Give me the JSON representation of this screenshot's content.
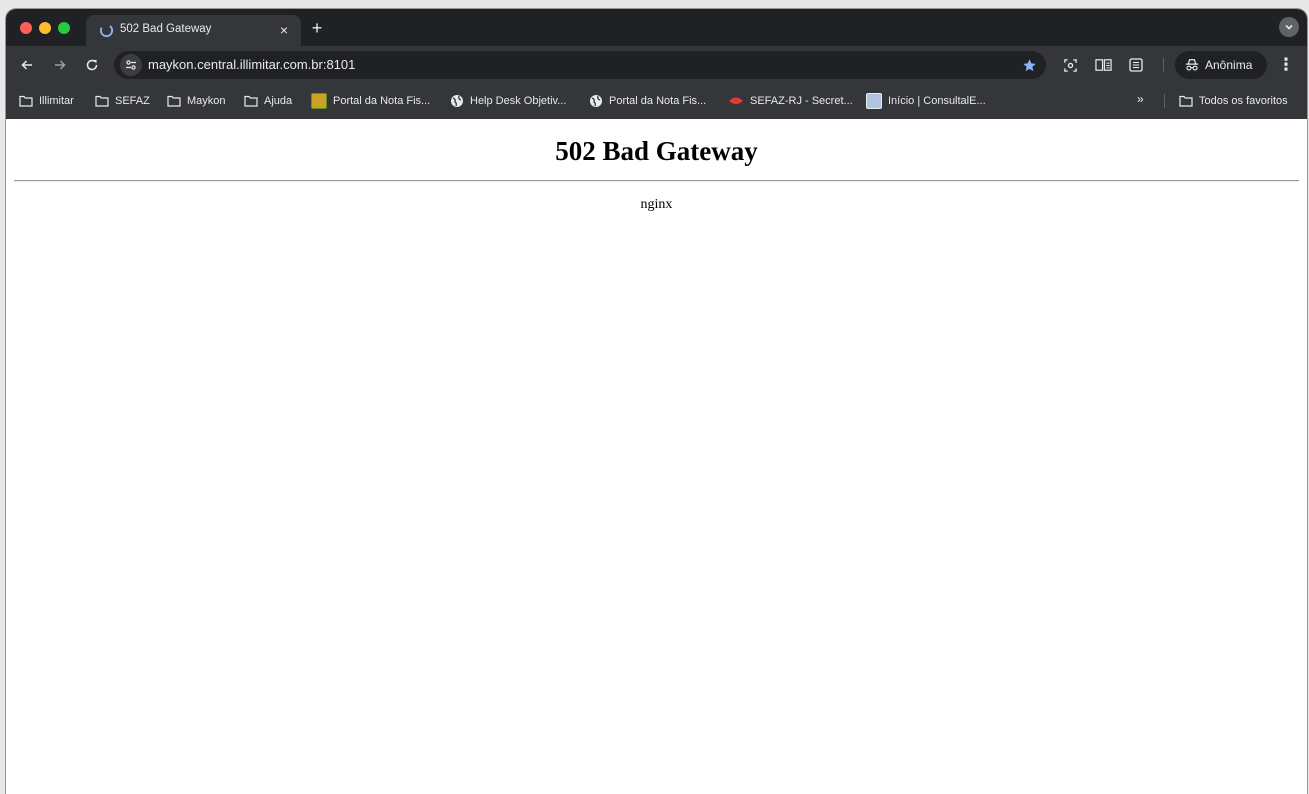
{
  "tab": {
    "title": "502 Bad Gateway",
    "close_glyph": "×",
    "new_tab_glyph": "+"
  },
  "toolbar": {
    "back_icon": "arrow-left",
    "forward_icon": "arrow-right",
    "reload_icon": "reload",
    "url": "maykon.central.illimitar.com.br:8101",
    "incognito_label": "Anônima",
    "menu_glyph": "⋮"
  },
  "bookmarks": {
    "items": [
      {
        "label": "Illimitar",
        "icon": "folder"
      },
      {
        "label": "SEFAZ",
        "icon": "folder"
      },
      {
        "label": "Maykon",
        "icon": "folder"
      },
      {
        "label": "Ajuda",
        "icon": "folder"
      },
      {
        "label": "Portal da Nota Fis...",
        "icon": "site-favicon"
      },
      {
        "label": "Help Desk Objetiv...",
        "icon": "globe"
      },
      {
        "label": "Portal da Nota Fis...",
        "icon": "globe"
      },
      {
        "label": "SEFAZ-RJ - Secret...",
        "icon": "site-favicon"
      },
      {
        "label": "Início | ConsultalE...",
        "icon": "site-favicon"
      }
    ],
    "overflow_glyph": "»",
    "all_bookmarks_label": "Todos os favoritos"
  },
  "page": {
    "heading": "502 Bad Gateway",
    "server": "nginx"
  },
  "colors": {
    "chrome_dark": "#202124",
    "chrome_toolbar": "#35363a",
    "text_light": "#e8eaed",
    "star_active": "#8ab4f8"
  }
}
